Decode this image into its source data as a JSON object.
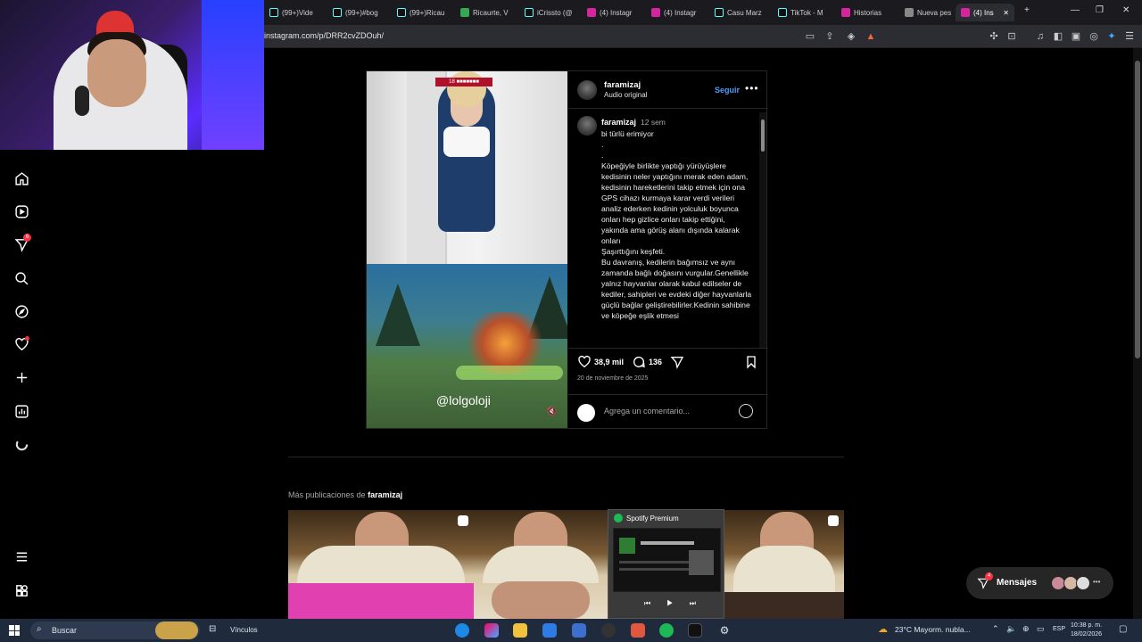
{
  "browser": {
    "tabs": [
      {
        "label": "(99+)Vide",
        "icon": "tiktok-icon"
      },
      {
        "label": "(99+)#bog",
        "icon": "tiktok-icon"
      },
      {
        "label": "(99+)Ricau",
        "icon": "tiktok-icon"
      },
      {
        "label": "Ricaurte, V",
        "icon": "maps-icon"
      },
      {
        "label": "iCrissto (@",
        "icon": "tiktok-icon"
      },
      {
        "label": "(4) Instagr",
        "icon": "instagram-icon"
      },
      {
        "label": "(4) Instagr",
        "icon": "instagram-icon"
      },
      {
        "label": "Casu Marz",
        "icon": "tiktok-icon"
      },
      {
        "label": "TikTok - M",
        "icon": "tiktok-icon"
      },
      {
        "label": "Historias",
        "icon": "instagram-icon"
      },
      {
        "label": "Nueva pes",
        "icon": "brave-icon"
      },
      {
        "label": "(4) Ins",
        "icon": "instagram-icon",
        "active": true
      }
    ],
    "url": "instagram.com/p/DRR2cvZDOuh/"
  },
  "sidebar": {
    "notifications_badge": "6"
  },
  "post": {
    "hud_label": "18 ■■■■■■■",
    "watermark": "@lolgoloji",
    "author": "faramizaj",
    "audio": "Audio original",
    "follow_label": "Seguir",
    "more_label": "•••",
    "caption_user": "faramizaj",
    "caption_time": "12 sem",
    "caption_text": "bi türlü erimiyor\n.\n.\nKöpeğiyle birlikte yaptığı yürüyüşlere kedisinin neler yaptığını merak eden adam, kedisinin hareketlerini takip etmek için ona\nGPS cihazı kurmaya karar verdi verileri analiz ederken kedinin yolculuk boyunca\nonları hep gizlice onları takip ettiğini, yakında ama görüş alanı dışında kalarak onları\nŞaşırttığını keşfeti.\nBu davranış, kedilerin bağımsız ve aynı zamanda bağlı doğasını vurgular.Genellikle yalnız hayvanlar olarak kabul edilseler de kediler, sahipleri ve evdeki diğer hayvanlarla güçlü bağlar geliştirebilirler.Kedinin sahibine ve köpeğe eşlik etmesi",
    "likes": "38,9 mil",
    "comments": "136",
    "date": "20 de noviembre de 2025",
    "comment_placeholder": "Agrega un comentario..."
  },
  "more_posts": {
    "title_prefix": "Más publicaciones de",
    "title_user": "faramizaj"
  },
  "spotify_popup": {
    "title": "Spotify Premium",
    "controls": "⏮ ▶ ⏭"
  },
  "messages": {
    "label": "Mensajes",
    "badge": "4",
    "more": "•••"
  },
  "taskbar": {
    "search_label": "Buscar",
    "links_label": "Vínculos",
    "weather": "23°C  Mayorm. nubla...",
    "lang": "ESP",
    "time": "10:38 p. m.",
    "date": "18/02/2026"
  },
  "colors": {
    "accent_blue": "#4a9dff",
    "badge_red": "#ff3040",
    "spotify_green": "#1db954"
  }
}
